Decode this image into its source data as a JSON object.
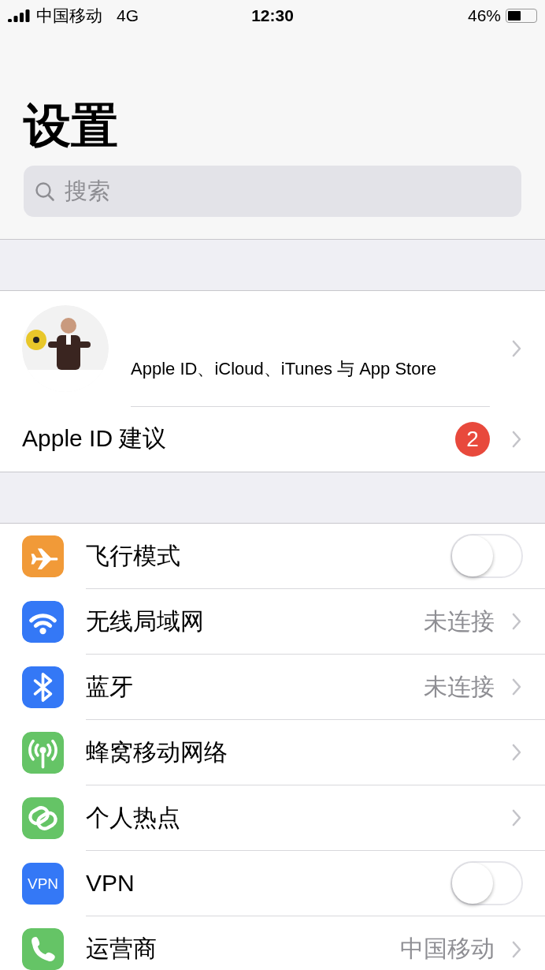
{
  "status_bar": {
    "carrier": "中国移动",
    "network": "4G",
    "time": "12:30",
    "battery": "46%"
  },
  "title": "设置",
  "search": {
    "placeholder": "搜索"
  },
  "profile": {
    "subtitle": "Apple ID、iCloud、iTunes 与 App Store"
  },
  "suggestion": {
    "label": "Apple ID 建议",
    "badge": "2"
  },
  "rows": [
    {
      "kind": "toggle",
      "label": "飞行模式",
      "color": "#f19a38",
      "on": false
    },
    {
      "kind": "value",
      "label": "无线局域网",
      "color": "#3478f6",
      "value": "未连接"
    },
    {
      "kind": "value",
      "label": "蓝牙",
      "color": "#3478f6",
      "value": "未连接"
    },
    {
      "kind": "link",
      "label": "蜂窝移动网络",
      "color": "#65c466"
    },
    {
      "kind": "link",
      "label": "个人热点",
      "color": "#65c466"
    },
    {
      "kind": "toggle",
      "label": "VPN",
      "color": "#3478f6",
      "icon_text": "VPN",
      "on": false
    },
    {
      "kind": "value",
      "label": "运营商",
      "color": "#65c466",
      "value": "中国移动"
    }
  ]
}
